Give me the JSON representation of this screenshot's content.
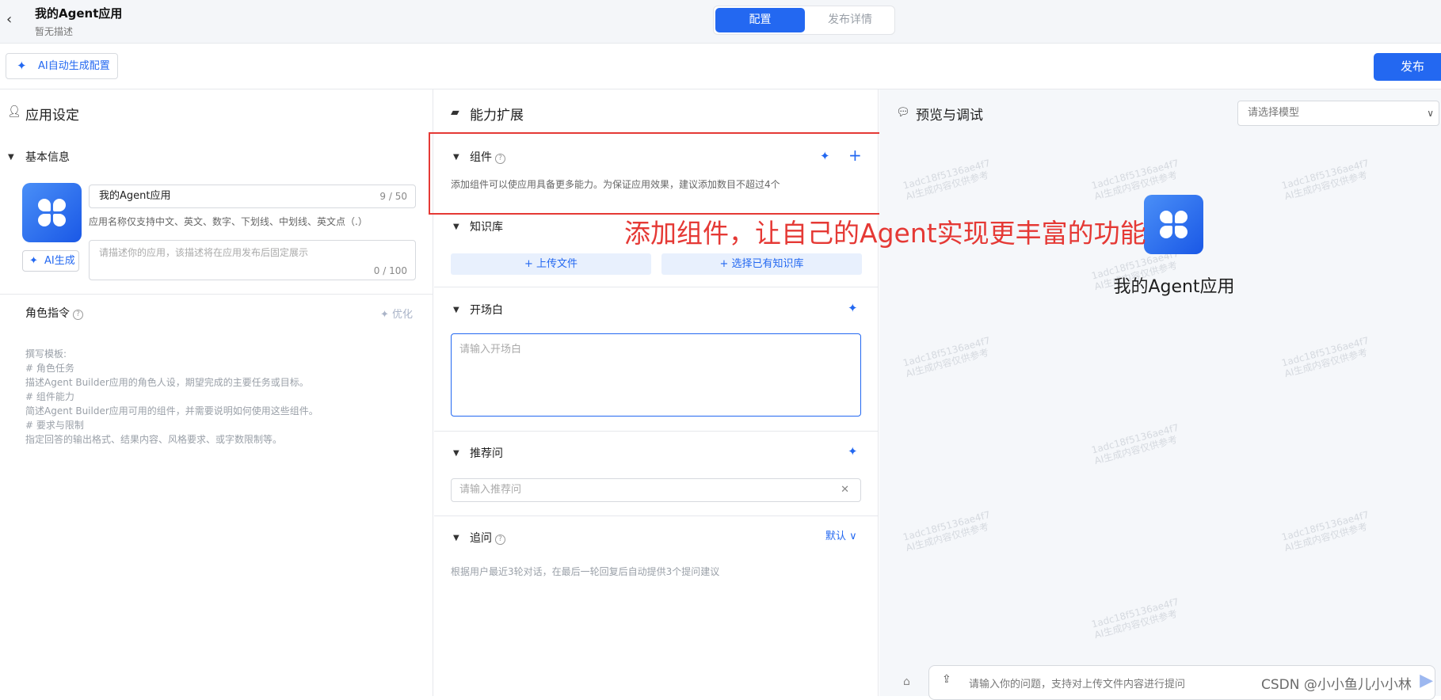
{
  "header": {
    "title": "我的Agent应用",
    "description": "暂无描述",
    "tabs": [
      {
        "label": "配置"
      },
      {
        "label": "发布详情"
      }
    ]
  },
  "toolbar": {
    "ai_generate_label": "AI自动生成配置",
    "publish_label": "发布"
  },
  "left": {
    "section_title": "应用设定",
    "basic_info_title": "基本信息",
    "app_name_value": "我的Agent应用",
    "app_name_count": "9 / 50",
    "app_name_hint": "应用名称仅支持中文、英文、数字、下划线、中划线、英文点（.）",
    "desc_placeholder": "请描述你的应用，该描述将在应用发布后固定展示",
    "desc_count": "0 / 100",
    "ai_button_label": "AI生成",
    "role_title": "角色指令",
    "role_optimize_label": "优化",
    "role_template": [
      "撰写模板:",
      "# 角色任务",
      "描述Agent Builder应用的角色人设，期望完成的主要任务或目标。",
      "# 组件能力",
      "简述Agent Builder应用可用的组件，并需要说明如何使用这些组件。",
      "# 要求与限制",
      "指定回答的输出格式、结果内容、风格要求、或字数限制等。"
    ]
  },
  "middle": {
    "section_title": "能力扩展",
    "components_title": "组件",
    "components_desc": "添加组件可以使应用具备更多能力。为保证应用效果，建议添加数目不超过4个",
    "knowledge_title": "知识库",
    "upload_file_label": "上传文件",
    "select_kb_label": "选择已有知识库",
    "opening_title": "开场白",
    "opening_placeholder": "请输入开场白",
    "recommend_title": "推荐问",
    "recommend_placeholder": "请输入推荐问",
    "followup_title": "追问",
    "followup_mode": "默认",
    "followup_desc": "根据用户最近3轮对话，在最后一轮回复后自动提供3个提问建议"
  },
  "annotation": "添加组件，让自己的Agent实现更丰富的功能",
  "right": {
    "section_title": "预览与调试",
    "model_placeholder": "请选择模型",
    "preview_name": "我的Agent应用",
    "watermark_line1": "1adc18f5136ae4f7",
    "watermark_line2": "AI生成内容仅供参考",
    "chat_placeholder": "请输入你的问题，支持对上传文件内容进行提问"
  },
  "footer_watermark": "CSDN @小小鱼儿小小林",
  "colors": {
    "accent": "#2368f1",
    "annotation": "#e53935"
  }
}
